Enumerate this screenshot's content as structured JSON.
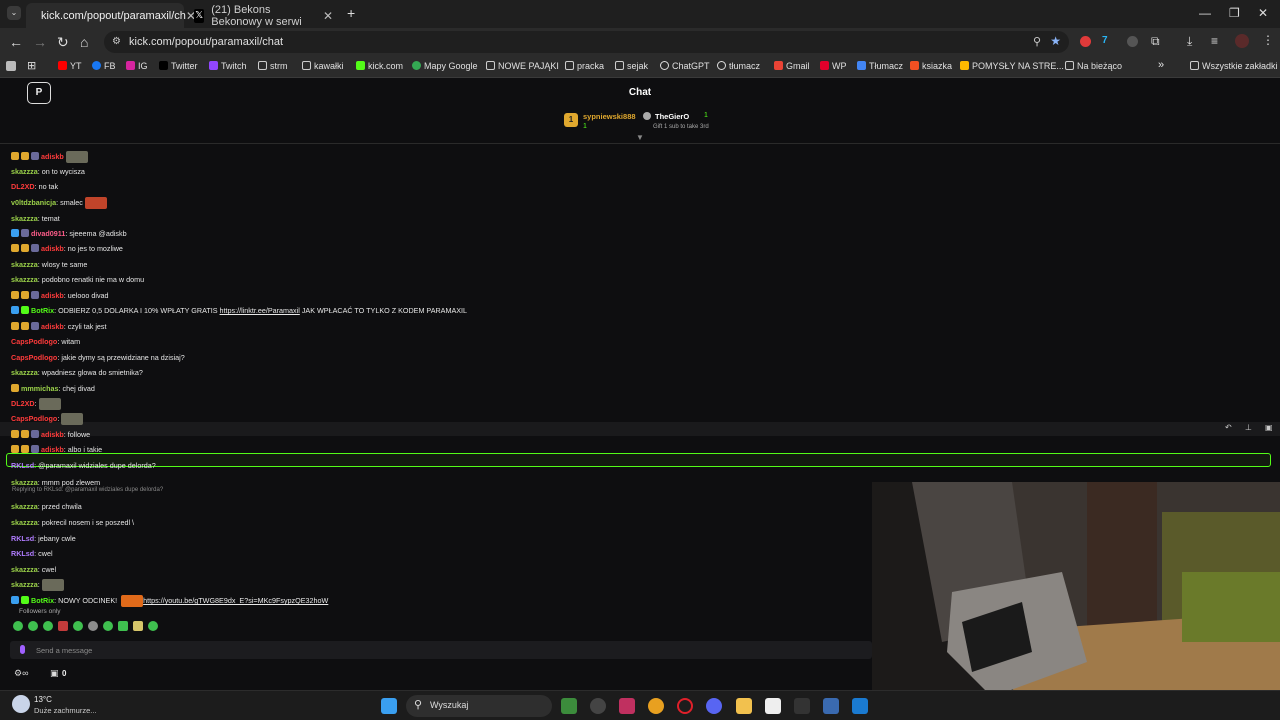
{
  "browser": {
    "tabs": [
      {
        "title": "kick.com/popout/paramaxil/ch"
      },
      {
        "title": "(21) Bekons Bekonowy w serwi"
      }
    ],
    "url": "kick.com/popout/paramaxil/chat",
    "bookmarks": [
      "YT",
      "FB",
      "IG",
      "Twitter",
      "Twitch",
      "strm",
      "kawałki",
      "kick.com",
      "Mapy Google",
      "NOWE PAJĄKI",
      "pracka",
      "sejak",
      "ChatGPT",
      "tłumacz",
      "Gmail",
      "WP",
      "Tłumacz",
      "ksiazka",
      "POMYSŁY NA STRE...",
      "Na bieżąco",
      "Wszystkie zakładki"
    ]
  },
  "chat": {
    "title": "Chat",
    "pinned": {
      "rank": "1",
      "leader_name": "sypniewski888",
      "leader_count": "1",
      "second_name": "TheGierO",
      "second_count": "1",
      "gift_text": "Gift 1 sub to take 3rd"
    },
    "messages": [
      {
        "user": "adiskb",
        "text": "",
        "color": "#ff3b3b",
        "emote": true
      },
      {
        "user": "skazzza",
        "text": ": on to wycisza",
        "color": "#9bd24a"
      },
      {
        "user": "DL2XD",
        "text": ": no tak",
        "color": "#ff3b3b"
      },
      {
        "user": "v0ltdzbanicja",
        "text": ": smalec",
        "color": "#9bd24a",
        "emote": true
      },
      {
        "user": "skazzza",
        "text": ": temat",
        "color": "#9bd24a"
      },
      {
        "user": "divad0911",
        "text": ": sjeeema @adiskb",
        "color": "#ff5d8a"
      },
      {
        "user": "adiskb",
        "text": ": no jes to mozliwe",
        "color": "#ff3b3b"
      },
      {
        "user": "skazzza",
        "text": ": wlosy te same",
        "color": "#9bd24a"
      },
      {
        "user": "skazzza",
        "text": ": podobno renatki nie ma w domu",
        "color": "#9bd24a"
      },
      {
        "user": "adiskb",
        "text": ": uelooo divad",
        "color": "#ff3b3b"
      },
      {
        "user": "BotRix",
        "text": ": ODBIERZ 0,5 DOLARKA I 10% WPŁATY GRATIS ",
        "link": "https://linktr.ee/Paramaxil",
        "after": " JAK WPŁACAĆ TO TYLKO Z KODEM PARAMAXIL",
        "color": "#53fc18"
      },
      {
        "user": "adiskb",
        "text": ": czyli tak jest",
        "color": "#ff3b3b"
      },
      {
        "user": "CapsPodlogo",
        "text": ": witam",
        "color": "#ff3b3b"
      },
      {
        "user": "CapsPodlogo",
        "text": ": jakie dymy są przewidziane na dzisiaj?",
        "color": "#ff3b3b"
      },
      {
        "user": "skazzza",
        "text": ": wpadniesz glowa do smietnika?",
        "color": "#9bd24a"
      },
      {
        "user": "mmmichas",
        "text": ": chej divad",
        "color": "#9bd24a"
      },
      {
        "user": "DL2XD",
        "text": ":",
        "color": "#ff3b3b",
        "emote": true
      },
      {
        "user": "CapsPodlogo",
        "text": ":",
        "color": "#ff3b3b",
        "emote": true
      },
      {
        "user": "adiskb",
        "text": ": followe",
        "color": "#ff3b3b"
      },
      {
        "user": "adiskb",
        "text": ": albo i takie",
        "color": "#ff3b3b"
      },
      {
        "user": "RKLsd",
        "text": ": @paramaxil widziales dupe delorda?",
        "color": "#b07cff"
      },
      {
        "user": "skazzza",
        "text": ": mmm pod zlewem",
        "color": "#9bd24a"
      },
      {
        "user": "skazzza",
        "text": ": przed chwila",
        "color": "#9bd24a"
      },
      {
        "user": "skazzza",
        "text": ": pokrecil nosem i se poszedl \\",
        "color": "#9bd24a"
      },
      {
        "user": "RKLsd",
        "text": ": jebany cwle",
        "color": "#b07cff"
      },
      {
        "user": "RKLsd",
        "text": ": cwel",
        "color": "#b07cff"
      },
      {
        "user": "skazzza",
        "text": ": cwel",
        "color": "#9bd24a"
      },
      {
        "user": "skazzza",
        "text": ":",
        "color": "#9bd24a",
        "emote": true
      },
      {
        "user": "BotRix",
        "text": ": NOWY ODCINEK! ",
        "link": "https://youtu.be/gTWG8E9dx_E?si=MKc9FsypzQE32hoW",
        "after": "",
        "color": "#53fc18",
        "emote": true
      }
    ],
    "reply_text": "Replying to RKLsd: @paramaxil widziales dupe delorda?",
    "followers_only": "Followers only",
    "input_placeholder": "Send a message",
    "points": "0"
  },
  "taskbar": {
    "weather_temp": "13°C",
    "weather_desc": "Duże zachmurze...",
    "search_placeholder": "Wyszukaj"
  }
}
